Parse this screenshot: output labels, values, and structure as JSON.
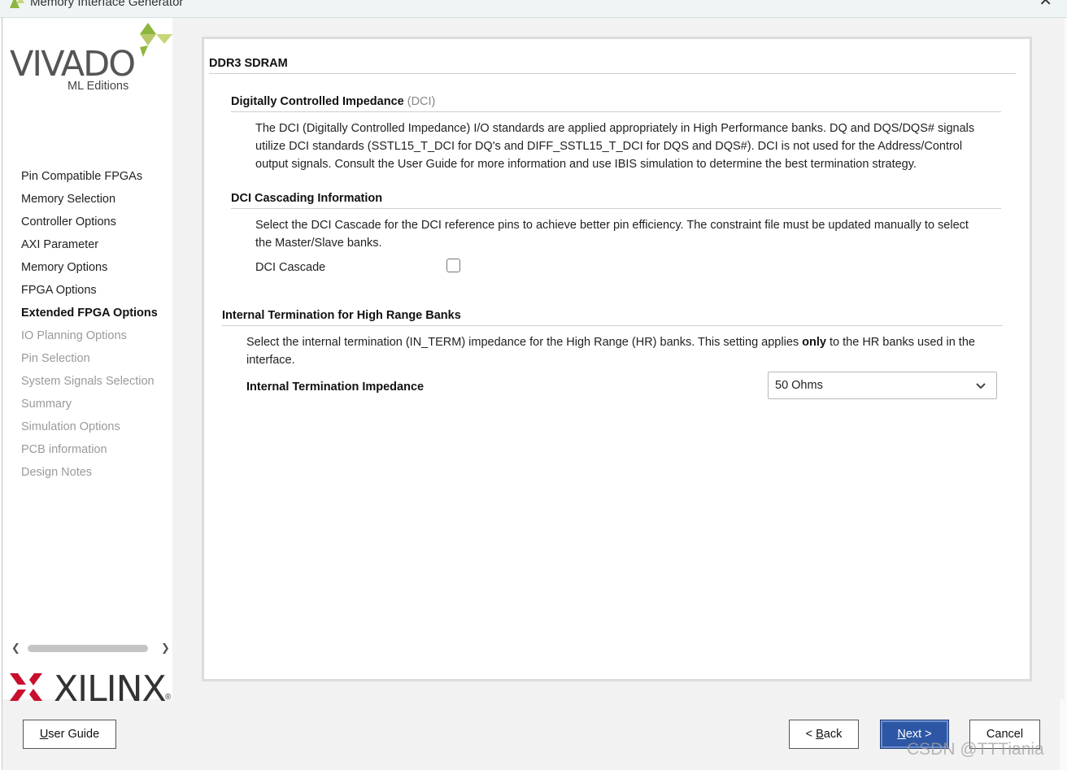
{
  "window": {
    "title": "Memory Interface Generator"
  },
  "branding": {
    "vivado": "VIVADO",
    "ml_editions": "ML Editions",
    "xilinx": "XILINX",
    "registered": "®"
  },
  "sidebar": {
    "items": [
      {
        "label": "Pin Compatible FPGAs",
        "state": "normal"
      },
      {
        "label": "Memory Selection",
        "state": "normal"
      },
      {
        "label": "Controller Options",
        "state": "normal"
      },
      {
        "label": "AXI Parameter",
        "state": "normal"
      },
      {
        "label": "Memory Options",
        "state": "normal"
      },
      {
        "label": "FPGA Options",
        "state": "normal"
      },
      {
        "label": "Extended FPGA Options",
        "state": "active"
      },
      {
        "label": "IO Planning Options",
        "state": "disabled"
      },
      {
        "label": "Pin Selection",
        "state": "disabled"
      },
      {
        "label": "System Signals Selection",
        "state": "disabled"
      },
      {
        "label": "Summary",
        "state": "disabled"
      },
      {
        "label": "Simulation Options",
        "state": "disabled"
      },
      {
        "label": "PCB information",
        "state": "disabled"
      },
      {
        "label": "Design Notes",
        "state": "disabled"
      }
    ]
  },
  "main": {
    "header": "DDR3 SDRAM",
    "dci": {
      "title": "Digitally Controlled Impedance",
      "title_suffix": "(DCI)",
      "description_lines": [
        "The DCI (Digitally Controlled Impedance) I/O standards are applied appropriately in High Performance banks. DQ and DQS/DQS# signals",
        "utilize DCI standards (SSTL15_T_DCI for DQ's and DIFF_SSTL15_T_DCI for DQS and DQS#). DCI is not used for the Address/Control",
        "output signals. Consult the User Guide for more information and use IBIS simulation to determine the best termination strategy."
      ]
    },
    "cascade": {
      "title": "DCI Cascading Information",
      "description_lines": [
        "Select the DCI Cascade for the DCI reference pins to achieve better pin efficiency. The constraint file must be updated manually to select",
        "the Master/Slave banks."
      ],
      "checkbox_label": "DCI Cascade",
      "checked": false
    },
    "interm": {
      "title": "Internal Termination for High Range Banks",
      "description_pre": "Select the internal termination (IN_TERM) impedance for the High Range (HR) banks. This setting applies ",
      "description_bold": "only",
      "description_post": " to the HR banks used in the",
      "description_line2": "interface.",
      "field_label": "Internal Termination Impedance",
      "selected_value": "50 Ohms"
    }
  },
  "buttons": {
    "user_guide": {
      "label": "User Guide",
      "mnemonic": "U",
      "rest": "ser Guide"
    },
    "back": {
      "label": "< Back",
      "pre": "< ",
      "mnemonic": "B",
      "rest": "ack"
    },
    "next": {
      "label": "Next >",
      "mnemonic": "N",
      "rest": "ext >"
    },
    "cancel": {
      "label": "Cancel"
    }
  },
  "watermark": "CSDN @TTTiania",
  "colors": {
    "accent_green": "#8cb63c",
    "xilinx_red": "#c8102e",
    "primary_button": "#2d56a4",
    "disabled_text": "#9a9a9a"
  }
}
